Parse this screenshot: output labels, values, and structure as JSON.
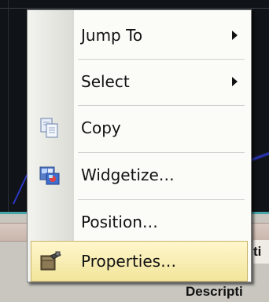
{
  "context_menu": {
    "items": [
      {
        "label": "Jump To",
        "submenu": true
      },
      {
        "label": "Select",
        "submenu": true
      },
      {
        "label": "Copy",
        "icon": "copy-icon"
      },
      {
        "label": "Widgetize…",
        "icon": "widgetize-icon"
      },
      {
        "label": "Position…"
      },
      {
        "label": "Properties…",
        "icon": "properties-icon",
        "highlighted": true
      }
    ],
    "highlight_color": "#f2e59b"
  },
  "background_app": {
    "partial_header_text": "ti",
    "description_header": "Descripti"
  }
}
